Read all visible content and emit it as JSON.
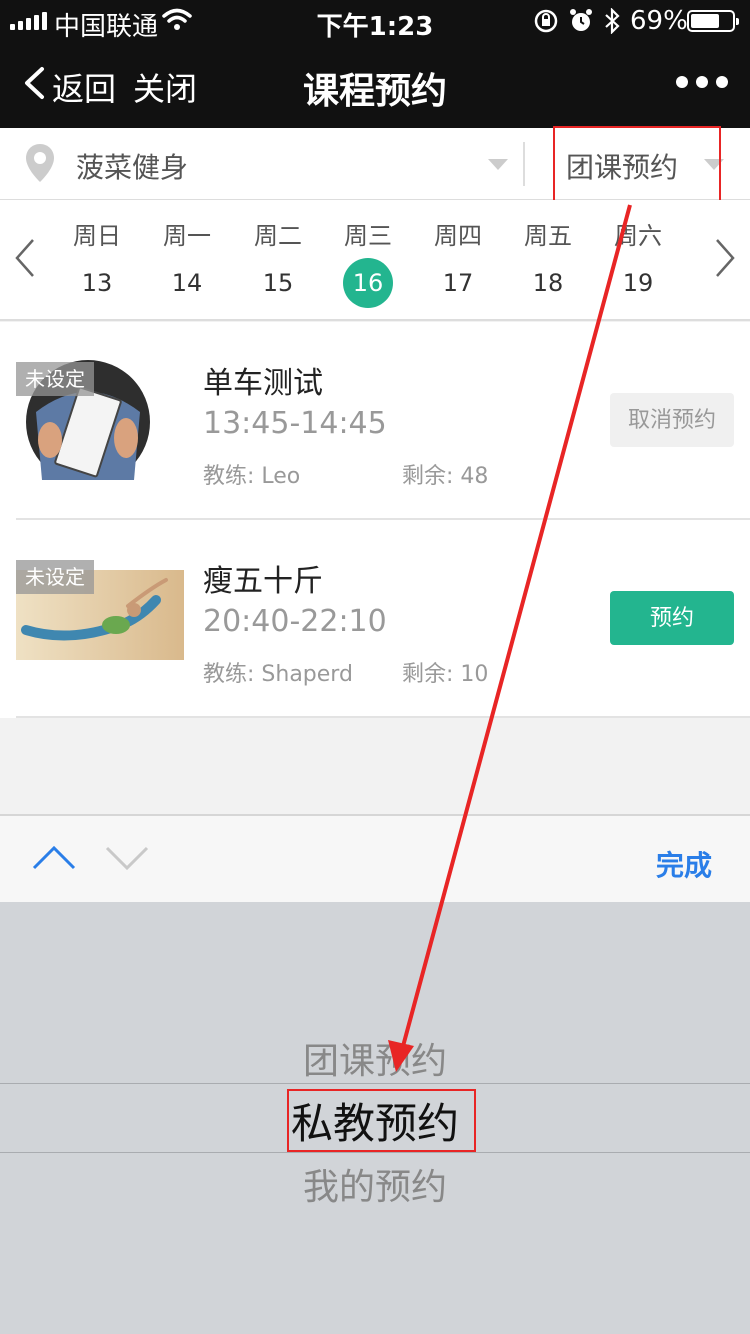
{
  "status_bar": {
    "carrier": "中国联通",
    "time": "下午1:23",
    "battery_percent": "69%",
    "battery_level": 0.69,
    "icons": [
      "signal-icon",
      "wifi-icon",
      "orientation-lock-icon",
      "alarm-icon",
      "bluetooth-icon",
      "battery-icon"
    ]
  },
  "nav": {
    "back_label": "返回",
    "close_label": "关闭",
    "title": "课程预约",
    "more_icon": "more-dots-icon"
  },
  "filter": {
    "gym_name": "菠菜健身",
    "booking_type": "团课预约",
    "location_icon": "location-pin-icon"
  },
  "week": {
    "days": [
      {
        "weekday": "周日",
        "date": "13"
      },
      {
        "weekday": "周一",
        "date": "14"
      },
      {
        "weekday": "周二",
        "date": "15"
      },
      {
        "weekday": "周三",
        "date": "16"
      },
      {
        "weekday": "周四",
        "date": "17"
      },
      {
        "weekday": "周五",
        "date": "18"
      },
      {
        "weekday": "周六",
        "date": "19"
      }
    ],
    "selected_date": "16"
  },
  "courses": [
    {
      "tag": "未设定",
      "name": "单车测试",
      "time": "13:45-14:45",
      "coach": "教练: Leo",
      "remaining": "剩余: 48",
      "action": "取消预约"
    },
    {
      "tag": "未设定",
      "name": "瘦五十斤",
      "time": "20:40-22:10",
      "coach": "教练: Shaperd",
      "remaining": "剩余: 10",
      "action": "预约"
    }
  ],
  "toolbar": {
    "done_label": "完成"
  },
  "picker": {
    "options": [
      "团课预约",
      "私教预约",
      "我的预约"
    ],
    "selected": "私教预约"
  },
  "colors": {
    "accent": "#23b58f",
    "toolbar_link": "#2a7ee8",
    "annotation": "#e82525",
    "header_bg": "#111111"
  }
}
